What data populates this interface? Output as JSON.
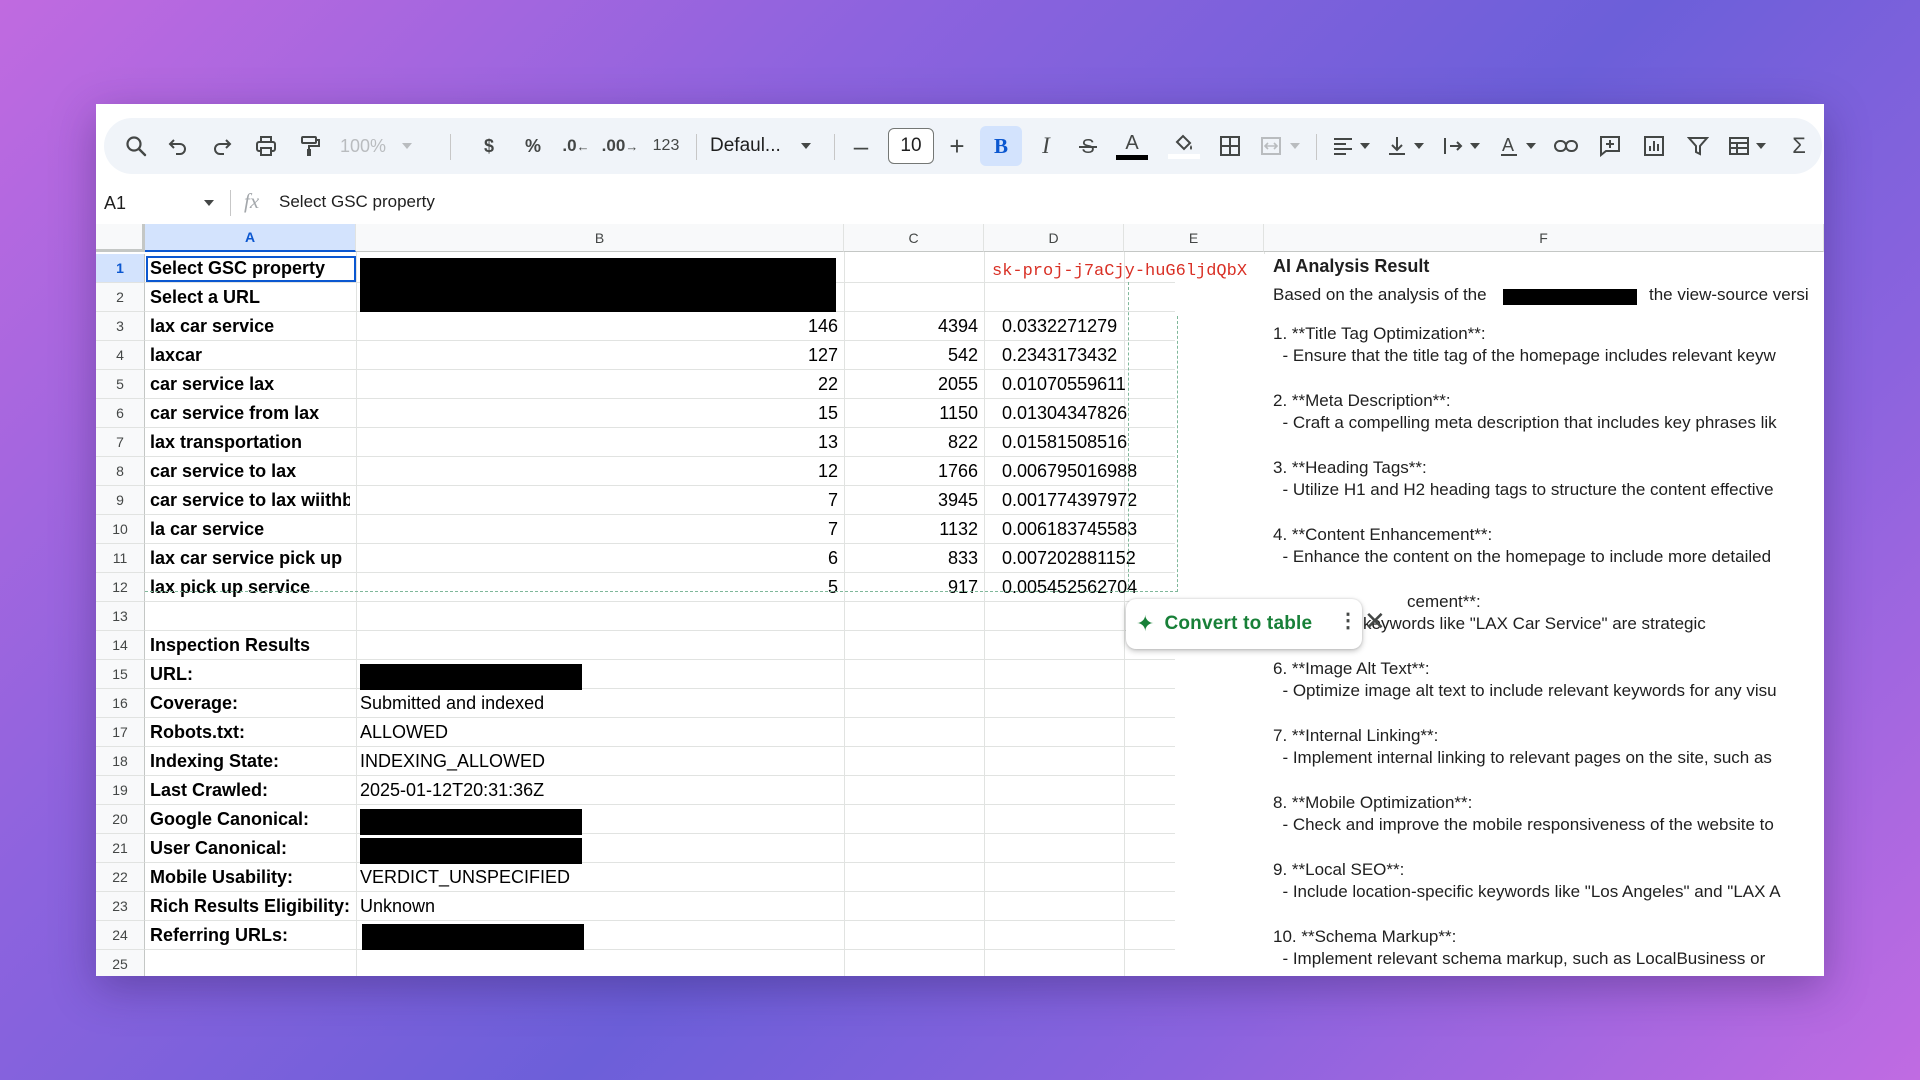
{
  "toolbar": {
    "zoom": "100%",
    "currency": "$",
    "percent": "%",
    "decrease_decimal": ".0",
    "increase_decimal": ".00",
    "number_format": "123",
    "font": "Defaul...",
    "font_size": "10",
    "bold": "B",
    "italic": "I",
    "text_color": "A",
    "text_color_swatch": "#000000",
    "fill_color_swatch": "#ffffff"
  },
  "formula_bar": {
    "cell_ref": "A1",
    "formula": "Select GSC property"
  },
  "columns": [
    "A",
    "B",
    "C",
    "D",
    "E",
    "F"
  ],
  "rows": [
    "1",
    "2",
    "3",
    "4",
    "5",
    "6",
    "7",
    "8",
    "9",
    "10",
    "11",
    "12",
    "13",
    "14",
    "15",
    "16",
    "17",
    "18",
    "19",
    "20",
    "21",
    "22",
    "23",
    "24",
    "25"
  ],
  "cells": {
    "a1": "Select GSC property",
    "a2": "Select a URL",
    "d1": "sk-proj-j7aCjy-huG6ljdQbX",
    "f1": "AI Analysis Result"
  },
  "keywords": [
    {
      "query": "lax car service",
      "b": "146",
      "c": "4394",
      "d": "0.0332271279"
    },
    {
      "query": "laxcar",
      "b": "127",
      "c": "542",
      "d": "0.2343173432"
    },
    {
      "query": "car service lax",
      "b": "22",
      "c": "2055",
      "d": "0.01070559611"
    },
    {
      "query": "car service from lax",
      "b": "15",
      "c": "1150",
      "d": "0.01304347826"
    },
    {
      "query": "lax transportation",
      "b": "13",
      "c": "822",
      "d": "0.01581508516"
    },
    {
      "query": "car service to lax",
      "b": "12",
      "c": "1766",
      "d": "0.006795016988"
    },
    {
      "query": "car service to lax wiithb",
      "b": "7",
      "c": "3945",
      "d": "0.001774397972"
    },
    {
      "query": "la car service",
      "b": "7",
      "c": "1132",
      "d": "0.006183745583"
    },
    {
      "query": "lax car service pick up",
      "b": "6",
      "c": "833",
      "d": "0.007202881152"
    },
    {
      "query": "lax pick up service",
      "b": "5",
      "c": "917",
      "d": "0.005452562704"
    }
  ],
  "inspection": {
    "title": "Inspection Results",
    "url_label": "URL:",
    "coverage_label": "Coverage:",
    "coverage_value": "Submitted and indexed",
    "robots_label": "Robots.txt:",
    "robots_value": "ALLOWED",
    "indexing_label": "Indexing State:",
    "indexing_value": "INDEXING_ALLOWED",
    "crawled_label": "Last Crawled:",
    "crawled_value": "2025-01-12T20:31:36Z",
    "google_canonical_label": "Google Canonical:",
    "user_canonical_label": "User Canonical:",
    "mobile_label": "Mobile Usability:",
    "mobile_value": "VERDICT_UNSPECIFIED",
    "rich_label": "Rich Results Eligibility:",
    "rich_value": "Unknown",
    "referring_label": "Referring URLs:"
  },
  "ai_panel": {
    "title": "AI Analysis Result",
    "intro_start": "Based on the analysis of the",
    "intro_end": "the view-source versi",
    "lines": [
      "1. **Title Tag Optimization**:",
      "  - Ensure that the title tag of the homepage includes relevant keyw",
      "2. **Meta Description**:",
      "  - Craft a compelling meta description that includes key phrases lik",
      "3. **Heading Tags**:",
      "  - Utilize H1 and H2 heading tags to structure the content effective",
      "4. **Content Enhancement**:",
      "  - Enhance the content on the homepage to include more detailed",
      "cement**:",
      "rget keywords like \"LAX Car Service\" are strategic",
      "6. **Image Alt Text**:",
      "  - Optimize image alt text to include relevant keywords for any visu",
      "7. **Internal Linking**:",
      "  - Implement internal linking to relevant pages on the site, such as",
      "8. **Mobile Optimization**:",
      "  - Check and improve the mobile responsiveness of the website to",
      "9. **Local SEO**:",
      "  - Include location-specific keywords like \"Los Angeles\" and \"LAX A",
      "10. **Schema Markup**:",
      "  - Implement relevant schema markup, such as LocalBusiness or"
    ]
  },
  "popup": {
    "label": "Convert to table",
    "more": "⋮",
    "close": "✕"
  }
}
